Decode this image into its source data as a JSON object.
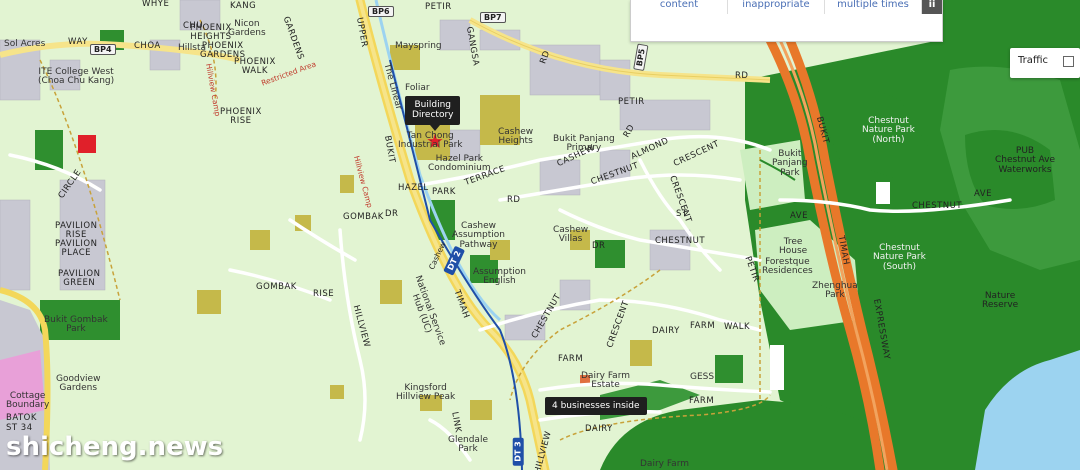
{
  "toolbar": {
    "tabs": [
      "content",
      "inappropriate",
      "multiple times"
    ],
    "icon_label": "ii"
  },
  "traffic_toggle": {
    "label": "Traffic",
    "checked": false
  },
  "tooltips": {
    "building": "Building\nDirectory",
    "businesses": "4 businesses inside"
  },
  "watermark": "shicheng.news",
  "mrt": {
    "bp6": "BP6",
    "bp7": "BP7",
    "bp4": "BP4",
    "bp5": "BP5",
    "dt2": "DT 2",
    "dt3": "DT 3",
    "cashew_station": "Cashew"
  },
  "labels": {
    "maysprings": "Mayspring",
    "tan_chong": "Tan Chong\nIndustrial Park",
    "hazel_park_condo": "Hazel Park\nCondominium",
    "cashew_heights": "Cashew\nHeights",
    "bukit_panjang_primary": "Bukit Panjang\nPrimary",
    "bukit_panjang_park": "Bukit\nPanjang\nPark",
    "chestnut_north": "Chestnut\nNature Park\n(North)",
    "chestnut_south": "Chestnut\nNature Park\n(South)",
    "pub_waterworks": "PUB\nChestnut Ave\nWaterworks",
    "nature_reserve": "Nature\nReserve",
    "tree_house": "Tree\nHouse",
    "forestque": "Forestque\nResidences",
    "zhenghua_park": "Zhenghua\nPark",
    "cashew_assumption": "Cashew\nAssumption\nPathway",
    "assumption_english": "Assumption\nEnglish",
    "cashew_villas": "Cashew\nVillas",
    "national_service": "National Service\nHub (UC)",
    "kingsford": "Kingsford\nHillview Peak",
    "glendale": "Glendale\nPark",
    "bukit_gombak_park": "Bukit Gombak\nPark",
    "goodview": "Goodview\nGardens",
    "cottage": "Cottage\nBoundary",
    "batok": "BATOK",
    "st34": "ST 34",
    "dairy_farm": "Dairy Farm",
    "ite": "ITE College West\n(Choa Chu Kang)",
    "hillsta": "Hillsta",
    "nicon": "Nicon\nGardens",
    "pavilion_rise": "PAVILION\nRISE",
    "pavilion_place": "PAVILION\nPLACE",
    "pavilion_green": "PAVILION\nGREEN",
    "sol_acres": "Sol Acres",
    "foliar": "Foliar",
    "the_linear": "The Linear",
    "phoenix_gardens": "PHOENIX\nGARDENS",
    "phoenix_walk": "PHOENIX\nWALK",
    "phoenix_rise": "PHOENIX\nRISE",
    "phoenix_heights": "PHOENIX\nHEIGHTS",
    "hillview_camp": "Hillview Camp",
    "hillview_camp2": "Hillview Camp",
    "restricted": "Restricted Area",
    "gess": "GESS",
    "dairy_farm_estate": "Dairy Farm\nEstate"
  },
  "streets": {
    "whye": "WHYE",
    "chu": "CHU",
    "kang": "KANG",
    "choa": "CHOA",
    "way": "WAY",
    "upper": "UPPER",
    "petir": "PETIR",
    "gangsa": "GANGSA",
    "rd": "RD",
    "hazel": "HAZEL",
    "park": "PARK",
    "terrace": "TERRACE",
    "cashew": "CASHEW",
    "chestnut": "CHESTNUT",
    "almond": "ALMOND",
    "crescent": "CRESCENT",
    "ave": "AVE",
    "dr": "DR",
    "st": "ST",
    "gombak": "GOMBAK",
    "rise": "RISE",
    "hillview": "HILLVIEW",
    "dairy": "DAIRY",
    "farm": "FARM",
    "walk": "WALK",
    "timah": "TIMAH",
    "bukit": "BUKIT",
    "expressway": "EXPRESSWAY",
    "link": "LINK",
    "circle": "CIRCLE",
    "gardens": "GARDENS",
    "rd2": "RD"
  },
  "colors": {
    "land": "#e2f4d2",
    "forest": "#2a8a2a",
    "expressway": "#e8782a",
    "water": "#9cd3f0",
    "building": "#c8c8d2",
    "highlight_red": "#e0202a"
  }
}
